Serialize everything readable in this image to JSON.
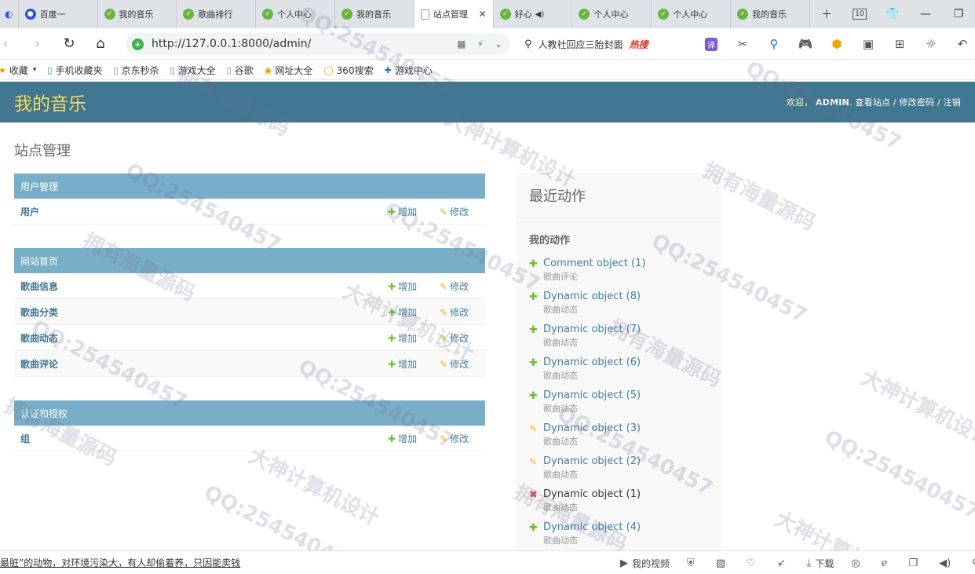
{
  "browser": {
    "tabs": [
      {
        "label": "百度一",
        "favicon": "baidu-paw-icon"
      },
      {
        "label": "我的音乐",
        "favicon": "django-leaf-icon"
      },
      {
        "label": "歌曲排行",
        "favicon": "django-leaf-icon"
      },
      {
        "label": "个人中心",
        "favicon": "django-leaf-icon"
      },
      {
        "label": "我的音乐",
        "favicon": "django-leaf-icon"
      },
      {
        "label": "站点管理",
        "favicon": "page-icon",
        "active": true
      },
      {
        "label": "好心",
        "favicon": "django-leaf-icon",
        "audio": true
      },
      {
        "label": "个人中心",
        "favicon": "django-leaf-icon"
      },
      {
        "label": "个人中心",
        "favicon": "django-leaf-icon"
      },
      {
        "label": "我的音乐",
        "favicon": "django-leaf-icon"
      }
    ],
    "tab_count": "10",
    "url": "http://127.0.0.1:8000/admin/",
    "search_suggestion": "人教社回应三胎封面",
    "hot_label": "热搜",
    "translate_label": "译",
    "bookmarks": [
      {
        "label": "收藏",
        "icon": "star-icon"
      },
      {
        "label": "手机收藏夹",
        "icon": "phone-icon"
      },
      {
        "label": "京东秒杀",
        "icon": "page-icon"
      },
      {
        "label": "游戏大全",
        "icon": "page-icon"
      },
      {
        "label": "谷歌",
        "icon": "page-icon"
      },
      {
        "label": "网址大全",
        "icon": "globe-icon"
      },
      {
        "label": "360搜索",
        "icon": "search-icon"
      },
      {
        "label": "游戏中心",
        "icon": "game-icon"
      }
    ],
    "status": {
      "news": "最脏”的动物，对环境污染大，有人却偷着养，只因能卖钱",
      "video_label": "我的视频",
      "download_label": "下载"
    }
  },
  "admin": {
    "site_title": "我的音乐",
    "welcome": "欢迎，",
    "username": "ADMIN",
    "view_site": "查看站点",
    "change_password": "修改密码",
    "logout": "注销",
    "separator": "/",
    "page_title": "站点管理",
    "add_label": "增加",
    "change_label": "修改",
    "modules": [
      {
        "caption": "用户管理",
        "rows": [
          "用户"
        ]
      },
      {
        "caption": "网站首页",
        "rows": [
          "歌曲信息",
          "歌曲分类",
          "歌曲动态",
          "歌曲评论"
        ]
      },
      {
        "caption": "认证和授权",
        "rows": [
          "组"
        ]
      }
    ],
    "recent_actions": {
      "title": "最近动作",
      "subtitle": "我的动作",
      "items": [
        {
          "name": "Comment object (1)",
          "type": "歌曲评论",
          "action": "add"
        },
        {
          "name": "Dynamic object (8)",
          "type": "歌曲动态",
          "action": "add"
        },
        {
          "name": "Dynamic object (7)",
          "type": "歌曲动态",
          "action": "add"
        },
        {
          "name": "Dynamic object (6)",
          "type": "歌曲动态",
          "action": "add"
        },
        {
          "name": "Dynamic object (5)",
          "type": "歌曲动态",
          "action": "add"
        },
        {
          "name": "Dynamic object (3)",
          "type": "歌曲动态",
          "action": "change"
        },
        {
          "name": "Dynamic object (2)",
          "type": "歌曲动态",
          "action": "change"
        },
        {
          "name": "Dynamic object (1)",
          "type": "歌曲动态",
          "action": "delete"
        },
        {
          "name": "Dynamic object (4)",
          "type": "歌曲动态",
          "action": "add"
        }
      ]
    }
  },
  "watermark": {
    "qq": "QQ:254540457",
    "a": "拥有海量源码",
    "b": "大神计算机设计"
  },
  "colors": {
    "header": "#417690",
    "module_caption": "#79aec8",
    "branding": "#f5dd5d",
    "link": "#447e9b",
    "add_green": "#70bf2b",
    "change_yellow": "#efb80b",
    "delete_red": "#dd4646"
  }
}
